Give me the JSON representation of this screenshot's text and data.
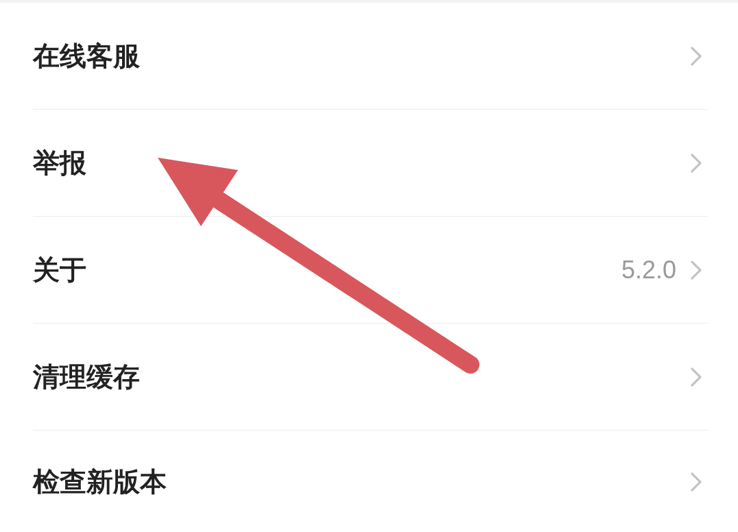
{
  "menu": {
    "items": [
      {
        "label": "在线客服"
      },
      {
        "label": "举报"
      },
      {
        "label": "关于",
        "value": "5.2.0"
      },
      {
        "label": "清理缓存"
      },
      {
        "label": "检查新版本"
      }
    ]
  },
  "annotations": [
    {
      "kind": "arrow"
    }
  ]
}
